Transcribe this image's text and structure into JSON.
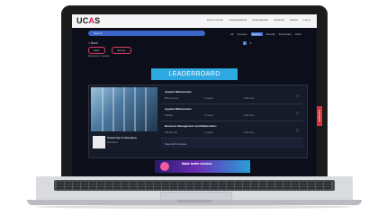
{
  "header": {
    "logo_main": "UC",
    "logo_accent": "A",
    "logo_end": "S",
    "nav_items": [
      "Find a course",
      "Undergraduate",
      "Postgraduate",
      "Teaching",
      "Advice",
      "Log in"
    ]
  },
  "search": {
    "placeholder": "Search"
  },
  "subnav": {
    "items": [
      "All",
      "Courses",
      "Events",
      "Results",
      "Favourites",
      "Clear"
    ],
    "selected": "Events"
  },
  "breadcrumb": {
    "back_label": "< Back"
  },
  "pagination": {
    "pages": [
      "1",
      "2"
    ],
    "active": "1"
  },
  "filters": {
    "chips": [
      "Filter",
      "Sort by"
    ]
  },
  "results": {
    "summary": "Showing 1 results"
  },
  "leaderboard": {
    "label": "LEADERBOARD"
  },
  "provider": {
    "name": "University of Aberdeen",
    "sub": "Scotland"
  },
  "courses": [
    {
      "title": "Applied Mathematics",
      "details": [
        "BSc (Hons)",
        "4 years",
        "Full time"
      ]
    },
    {
      "title": "Applied Mathematics",
      "details": [
        "MMath",
        "5 years",
        "Full time"
      ]
    },
    {
      "title": "Business Management and Mathematics",
      "details": [
        "MA (Hons)",
        "4 years",
        "Full time"
      ]
    }
  ],
  "footer": {
    "label": "View all 3 courses"
  },
  "banner": {
    "text": "Make better choices"
  },
  "side_tab": {
    "label": "Feedback"
  }
}
